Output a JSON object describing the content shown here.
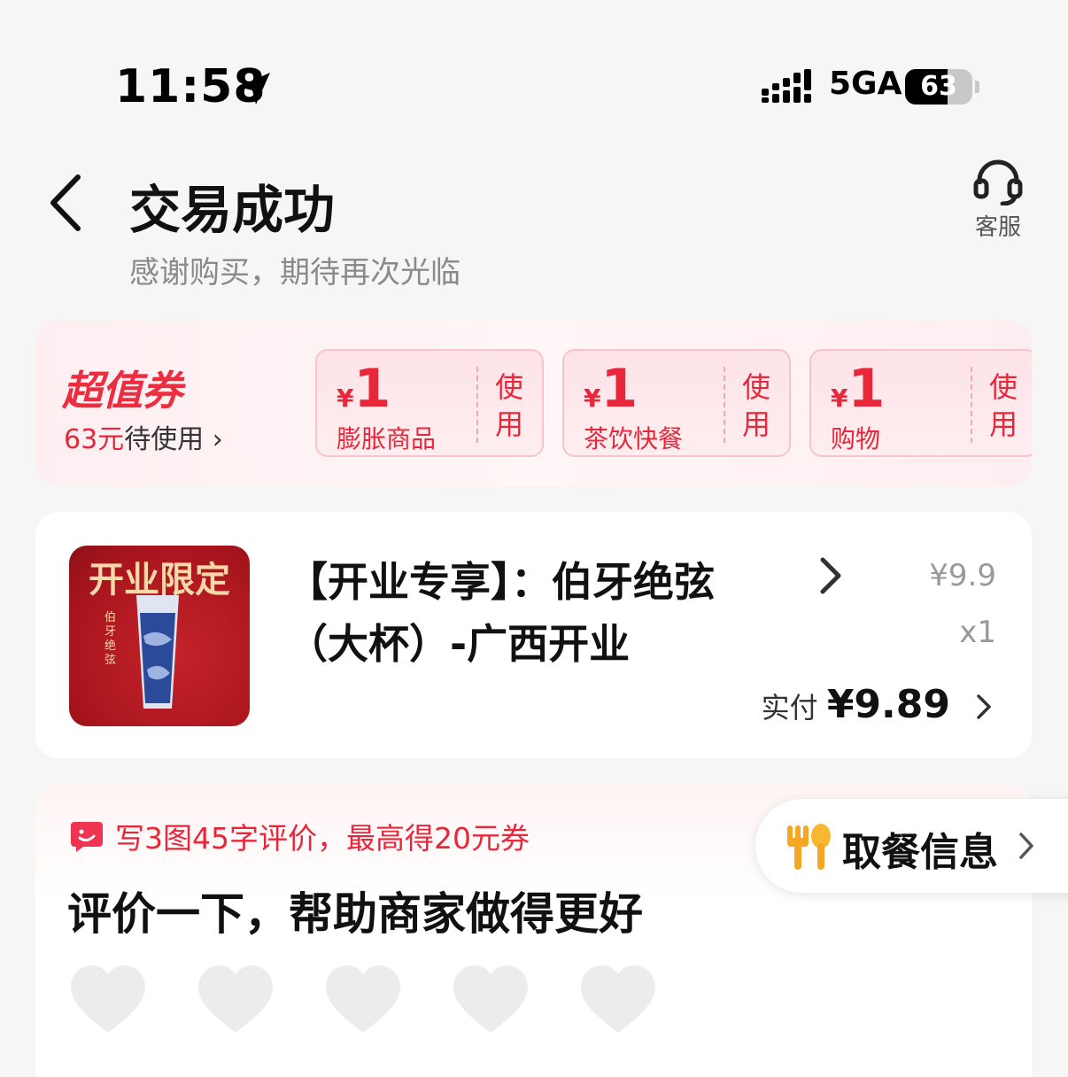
{
  "status_bar": {
    "time": "11:58",
    "network": "5GA",
    "battery": "63",
    "battery_level_percent": 63
  },
  "header": {
    "back_icon": "chevron-left-icon",
    "title": "交易成功",
    "subtitle": "感谢购买，期待再次光临",
    "service_label": "客服",
    "service_icon": "headset-icon"
  },
  "coupons": {
    "brand": "超值券",
    "pending_amount": "63元",
    "pending_label": "待使用",
    "tickets": [
      {
        "currency": "¥",
        "value": "1",
        "category": "膨胀商品",
        "action_line1": "使",
        "action_line2": "用"
      },
      {
        "currency": "¥",
        "value": "1",
        "category": "茶饮快餐",
        "action_line1": "使",
        "action_line2": "用"
      },
      {
        "currency": "¥",
        "value": "1",
        "category": "购物",
        "action_line1": "使",
        "action_line2": "用"
      }
    ]
  },
  "order": {
    "image_title": "开业限定",
    "image_side_text": "伯牙绝弦",
    "product_name": "【开业专享】：伯牙绝弦（大杯）-广西开业",
    "price": "¥9.9",
    "quantity": "x1",
    "paid_label": "实付",
    "paid_amount": "¥9.89"
  },
  "review": {
    "promo": "写3图45字评价，最高得20元券",
    "title": "评价一下，帮助商家做得更好",
    "rating_max": 5,
    "rating_value": 0
  },
  "pickup": {
    "label": "取餐信息",
    "icon": "utensils-icon"
  },
  "colors": {
    "accent": "#e8273a",
    "background": "#f6f6f6",
    "card": "#ffffff"
  }
}
